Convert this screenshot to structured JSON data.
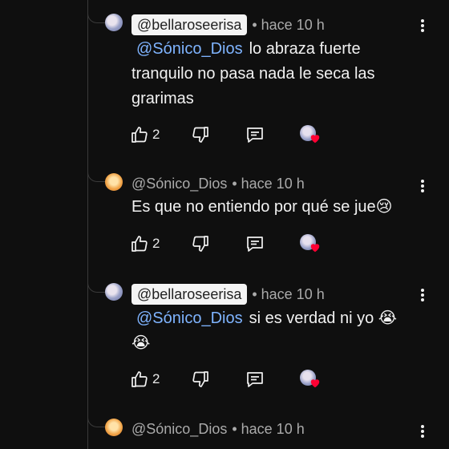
{
  "comments": [
    {
      "handle": "@bellaroseerisa",
      "time": "• hace 10 h",
      "mention": "@Sónico_Dios",
      "text": "lo abraza fuerte tranquilo no pasa nada le seca las grarimas",
      "likes": "2"
    },
    {
      "handle": "@Sónico_Dios",
      "time": "• hace 10 h",
      "text": "Es que no entiendo por qué se jue😢",
      "likes": "2"
    },
    {
      "handle": "@bellaroseerisa",
      "time": "• hace 10 h",
      "mention": "@Sónico_Dios",
      "text": "si es verdad ni yo 😭",
      "text2": "😭",
      "likes": "2"
    },
    {
      "handle": "@Sónico_Dios",
      "time": "• hace 10 h"
    }
  ],
  "icons": {
    "like": "thumbs-up-icon",
    "dislike": "thumbs-down-icon",
    "reply": "reply-icon",
    "more": "more-vertical-icon",
    "creator_heart": "creator-heart-icon"
  },
  "colors": {
    "background": "#0f0f0f",
    "mention": "#7fb4ff",
    "heart": "#ff0033"
  }
}
